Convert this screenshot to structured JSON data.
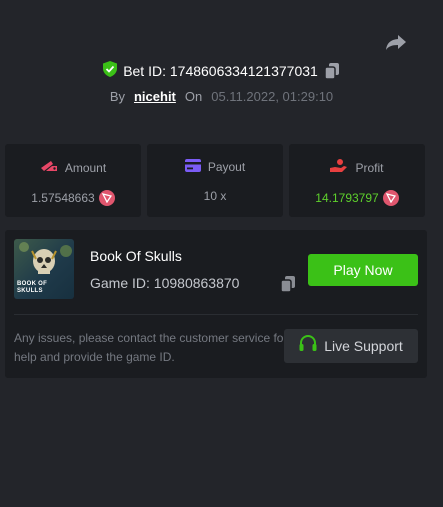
{
  "header": {
    "bet_id": "Bet ID: 1748606334121377031",
    "by_label": "By",
    "username": "nicehit",
    "on_label": "On",
    "date": "05.11.2022, 01:29:10"
  },
  "stats": [
    {
      "label": "Amount",
      "value": "1.57548663",
      "icon": "wallet-icon",
      "currency_icon": "trx-coin-icon"
    },
    {
      "label": "Payout",
      "value": "10 x",
      "icon": "card-icon"
    },
    {
      "label": "Profit",
      "value": "14.1793797",
      "icon": "profit-hand-icon",
      "currency_icon": "trx-coin-icon"
    }
  ],
  "game": {
    "title": "Book Of Skulls",
    "id_text": "Game ID: 10980863870",
    "thumb_text": "BOOK OF SKULLS",
    "play_label": "Play Now"
  },
  "support": {
    "message": "Any issues, please contact the customer service for help and provide the game ID.",
    "button_label": "Live Support"
  },
  "colors": {
    "background": "#23252a",
    "card": "#1a1c20",
    "accent_green": "#3bc117",
    "profit_green": "#5ed02c",
    "amount_icon": "#e84767",
    "payout_icon": "#7b5cf5",
    "profit_icon": "#e84040",
    "coin": "#e0566e"
  }
}
